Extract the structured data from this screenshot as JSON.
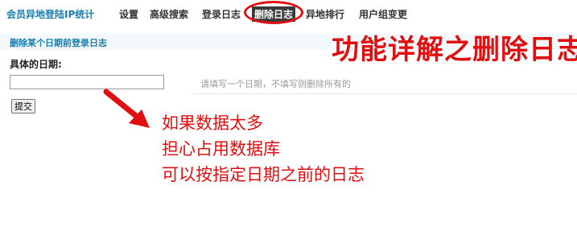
{
  "app_title": "会员异地登陆IP统计",
  "nav": {
    "items": [
      {
        "label": "设置"
      },
      {
        "label": "高级搜索"
      },
      {
        "label": "登录日志"
      },
      {
        "label": "删除日志"
      },
      {
        "label": "异地排行"
      },
      {
        "label": "用户组变更"
      }
    ],
    "active_index": 3
  },
  "section": {
    "title": "删除某个日期前登录日志"
  },
  "form": {
    "date_label": "具体的日期:",
    "date_value": "",
    "hint": "请填写一个日期，不填写则删除所有的",
    "submit_label": "提交"
  },
  "annotation": {
    "title": "功能详解之删除日志",
    "lines": [
      "如果数据太多",
      "担心占用数据库",
      "可以按指定日期之前的日志"
    ],
    "color": "#e01010"
  },
  "colors": {
    "accent": "#1a7fb0",
    "annotation": "#e01010",
    "active_nav_bg": "#3a3a3a"
  }
}
